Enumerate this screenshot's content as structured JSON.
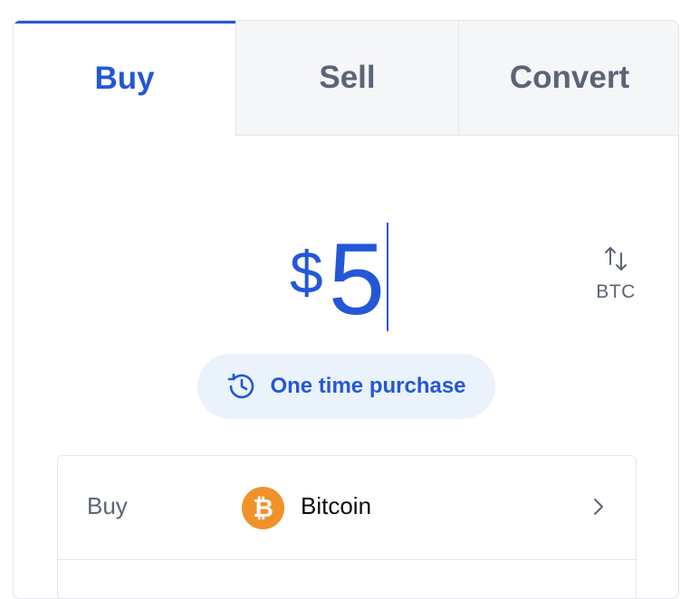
{
  "tabs": {
    "buy": "Buy",
    "sell": "Sell",
    "convert": "Convert"
  },
  "amount": {
    "currency_symbol": "$",
    "value": "5"
  },
  "swap": {
    "icon": "swap-arrows-icon",
    "label": "BTC"
  },
  "purchase_type": {
    "icon": "recurring-clock-icon",
    "label": "One time purchase"
  },
  "asset_row": {
    "label": "Buy",
    "asset_name": "Bitcoin",
    "asset_icon": "bitcoin-icon",
    "asset_icon_glyph": "₿",
    "chevron_icon": "chevron-right-icon"
  },
  "colors": {
    "accent": "#2457d8",
    "pill_bg": "#eaf2fb",
    "bitcoin": "#f09229",
    "muted_text": "#5b6576"
  }
}
